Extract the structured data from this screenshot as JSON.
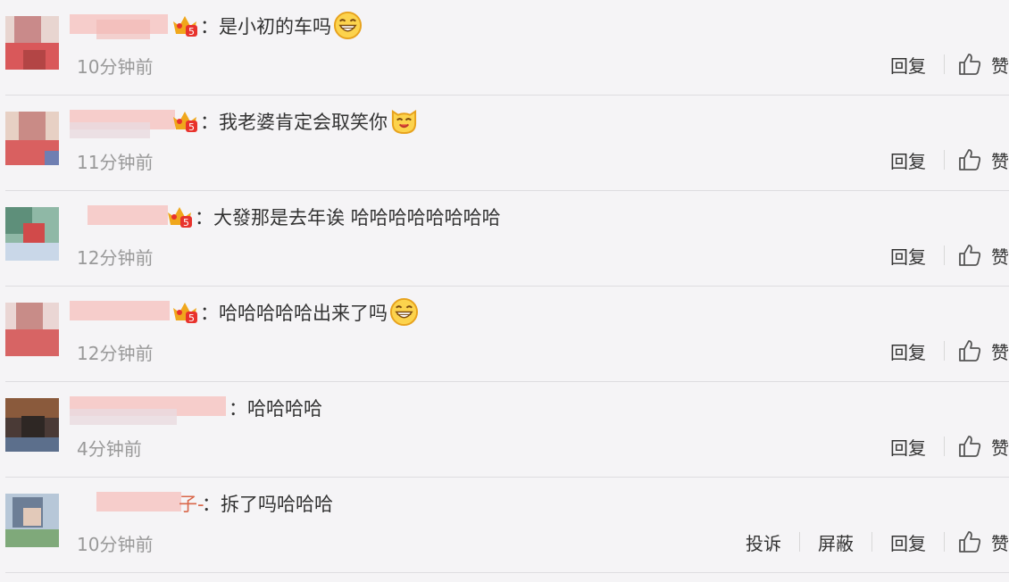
{
  "comments": [
    {
      "text": "是小初的车吗",
      "time": "10分钟前",
      "emoji": "grin-emoji",
      "badge": true
    },
    {
      "text": "我老婆肯定会取笑你",
      "time": "11分钟前",
      "emoji": "cat-emoji",
      "badge": true
    },
    {
      "text": "大發那是去年诶 哈哈哈哈哈哈哈哈",
      "time": "12分钟前",
      "emoji": "",
      "badge": true
    },
    {
      "text": "哈哈哈哈哈出来了吗",
      "time": "12分钟前",
      "emoji": "grin-emoji",
      "badge": true
    },
    {
      "text": "哈哈哈哈",
      "time": "4分钟前",
      "emoji": "",
      "badge": false
    },
    {
      "text": "拆了吗哈哈哈",
      "time": "10分钟前",
      "emoji": "",
      "badge": false
    }
  ],
  "name_suffix_6": "子-",
  "actions": {
    "reply": "回复",
    "like": "赞",
    "report": "投诉",
    "block": "屏蔽"
  },
  "colon": "："
}
